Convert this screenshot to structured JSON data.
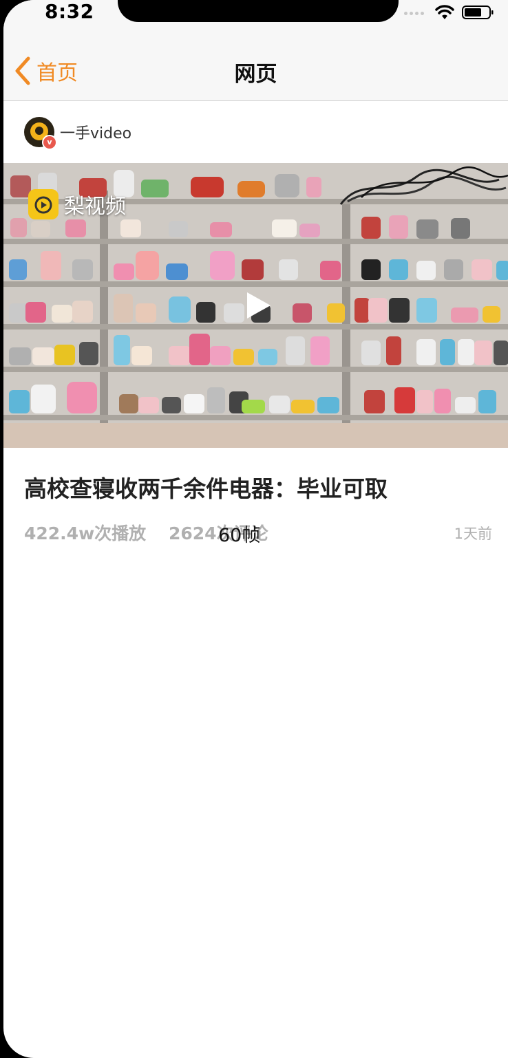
{
  "status_bar": {
    "time": "8:32"
  },
  "nav": {
    "back_label": "首页",
    "title": "网页"
  },
  "author": {
    "name": "一手video",
    "badge": "v"
  },
  "video": {
    "logo_text": "梨视频"
  },
  "article": {
    "title": "高校查寝收两千余件电器：毕业可取",
    "plays": "422.4w次播放",
    "comments": "2624次评论",
    "time_ago": "1天前"
  },
  "overlay": {
    "fps": "60帧"
  },
  "colors": {
    "accent": "#f08a24",
    "logo_yellow": "#f5c518"
  }
}
